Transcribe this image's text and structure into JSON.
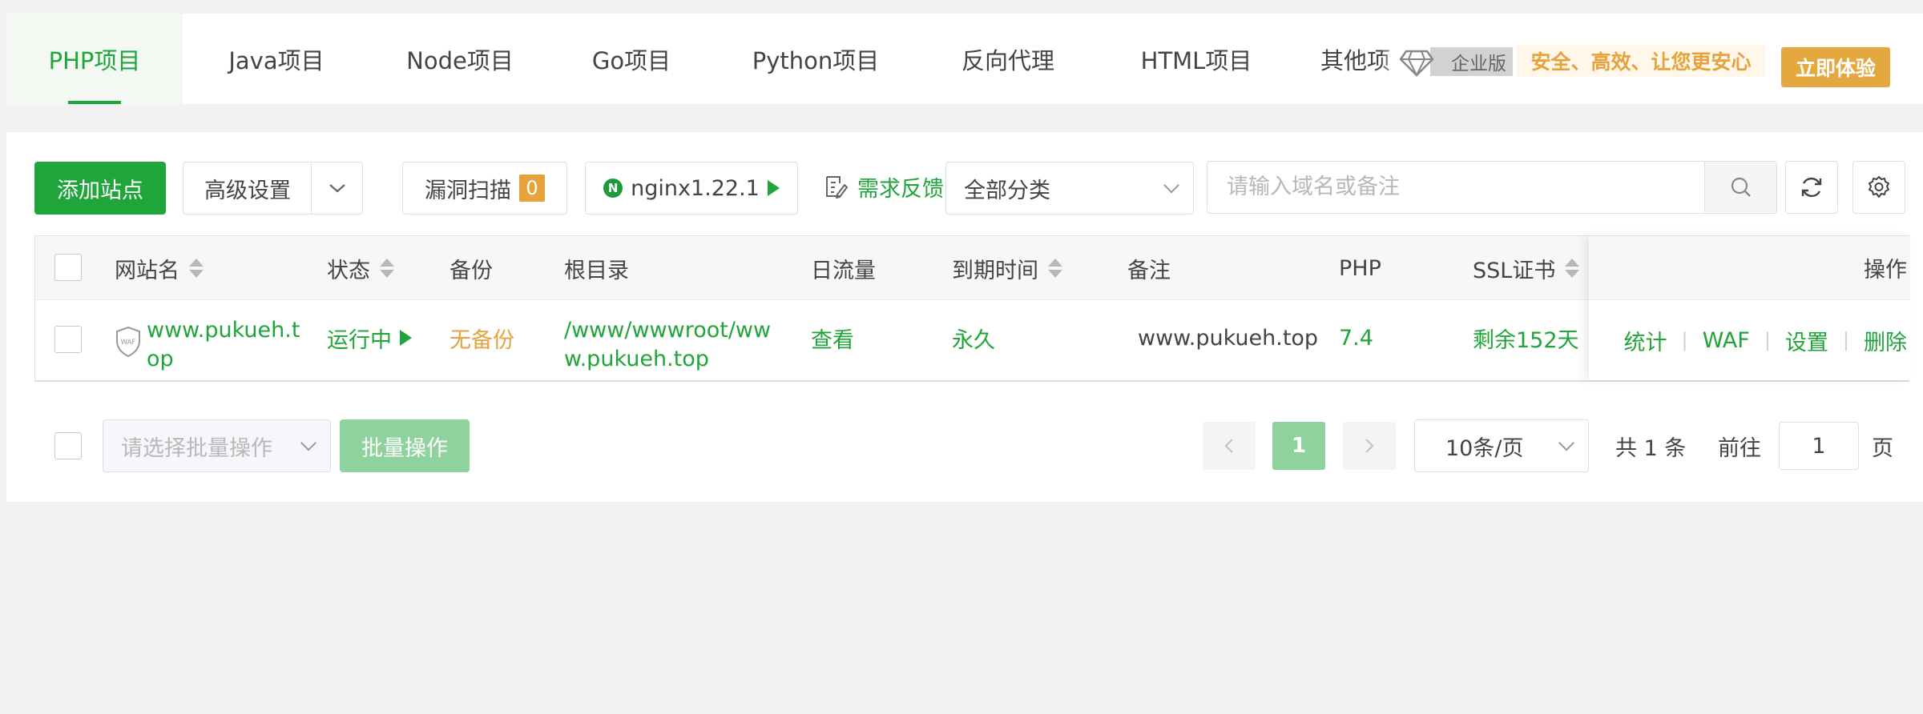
{
  "tabs": [
    {
      "label": "PHP项目",
      "active": true
    },
    {
      "label": "Java项目"
    },
    {
      "label": "Node项目"
    },
    {
      "label": "Go项目"
    },
    {
      "label": "Python项目"
    },
    {
      "label": "反向代理"
    },
    {
      "label": "HTML项目"
    },
    {
      "label": "其他项"
    }
  ],
  "promo": {
    "badge": "企业版",
    "text": "安全、高效、让您更安心",
    "button": "立即体验"
  },
  "toolbar": {
    "add_site": "添加站点",
    "advanced": "高级设置",
    "vuln_scan": "漏洞扫描",
    "vuln_count": "0",
    "nginx": "nginx1.22.1",
    "nginx_logo": "N",
    "feedback": "需求反馈",
    "category": "全部分类",
    "search_placeholder": "请输入域名或备注"
  },
  "table": {
    "headers": {
      "name": "网站名",
      "status": "状态",
      "backup": "备份",
      "root": "根目录",
      "traffic": "日流量",
      "expire": "到期时间",
      "remark": "备注",
      "php": "PHP",
      "ssl": "SSL证书",
      "ops": "操作"
    },
    "rows": [
      {
        "waf_badge": "WAF",
        "name_line1": "www.pukueh.t",
        "name_line2": "op",
        "status": "运行中",
        "backup": "无备份",
        "root_line1": "/www/wwwroot/ww",
        "root_line2": "w.pukueh.top",
        "traffic": "查看",
        "expire": "永久",
        "remark": "www.pukueh.top",
        "php": "7.4",
        "ssl": "剩余152天",
        "ops": [
          "统计",
          "WAF",
          "设置",
          "删除"
        ]
      }
    ]
  },
  "footer": {
    "batch_placeholder": "请选择批量操作",
    "batch_button": "批量操作",
    "current_page": "1",
    "page_size": "10条/页",
    "total": "共 1 条",
    "goto_label": "前往",
    "goto_value": "1",
    "page_suffix": "页"
  },
  "colors": {
    "primary": "#20a53a",
    "warning": "#e6a23c"
  }
}
